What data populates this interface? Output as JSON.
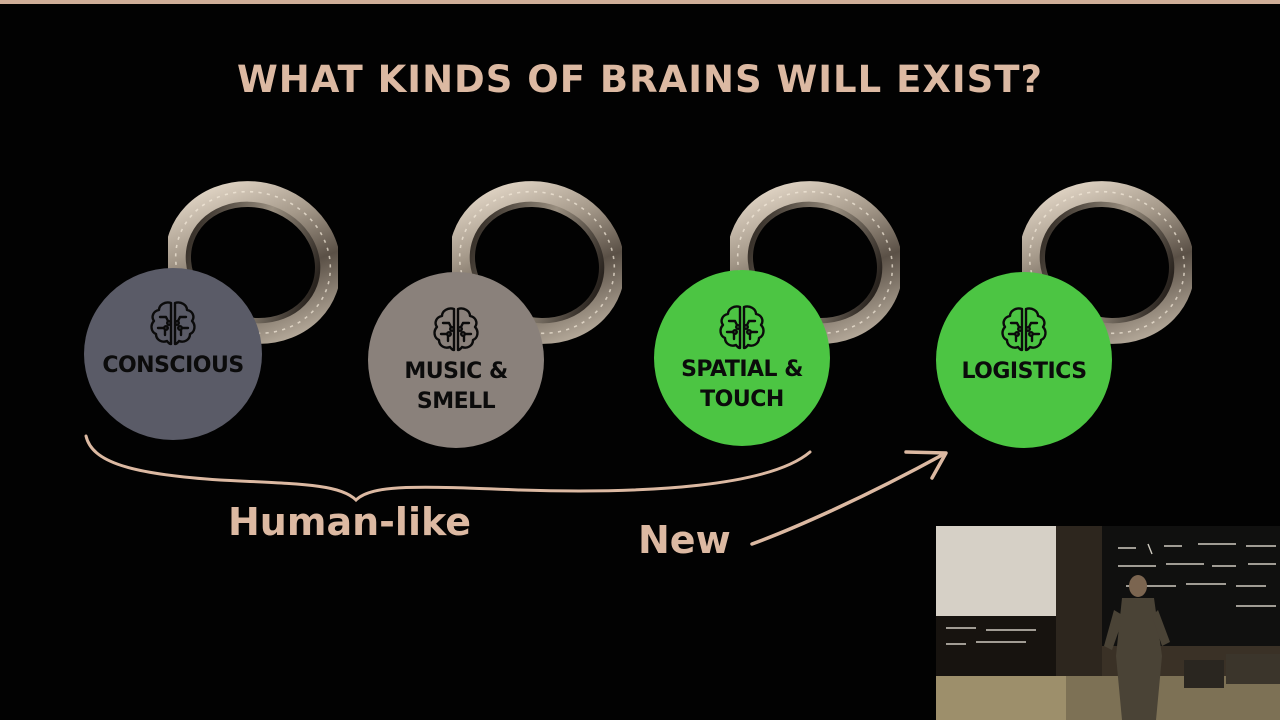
{
  "slide": {
    "title": "WHAT KINDS OF BRAINS WILL EXIST?",
    "brains": [
      {
        "label": "CONSCIOUS",
        "color": "#5a5b67"
      },
      {
        "label": "MUSIC & SMELL",
        "color": "#8a817b"
      },
      {
        "label": "SPATIAL & TOUCH",
        "color": "#4cc543"
      },
      {
        "label": "LOGISTICS",
        "color": "#4cc543"
      }
    ],
    "group_label": "Human-like",
    "new_label": "New",
    "icons": {
      "brain": "brain-circuit-icon",
      "ring": "one-ring-image"
    },
    "accent_color": "#dcb9a2"
  }
}
